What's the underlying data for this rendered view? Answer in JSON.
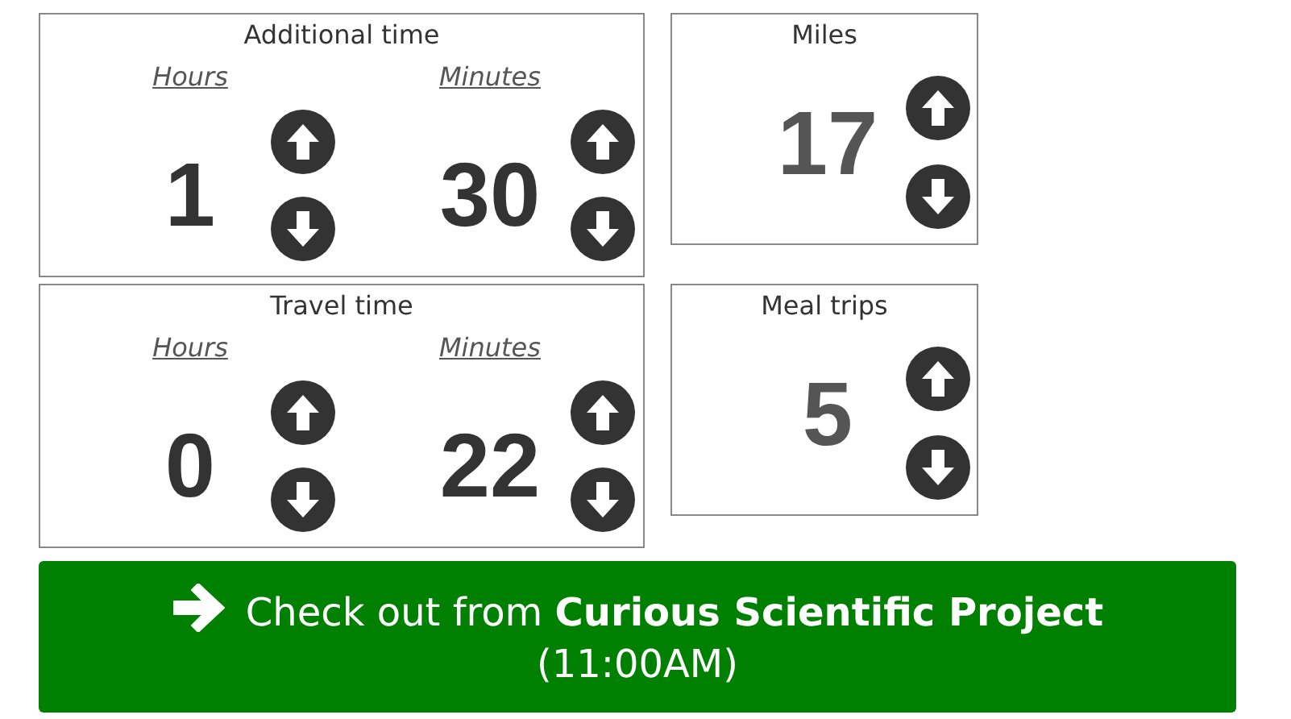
{
  "panels": [
    {
      "kind": "time",
      "title": "Additional time",
      "units": [
        {
          "label": "Hours",
          "value": "1"
        },
        {
          "label": "Minutes",
          "value": "30"
        }
      ]
    },
    {
      "kind": "count",
      "title": "Miles",
      "value": "17"
    },
    {
      "kind": "time",
      "title": "Travel time",
      "units": [
        {
          "label": "Hours",
          "value": "0"
        },
        {
          "label": "Minutes",
          "value": "22"
        }
      ]
    },
    {
      "kind": "count",
      "title": "Meal trips",
      "value": "5"
    }
  ],
  "checkout_button": {
    "text": "Check out from **Curious Scientific Project** (11:00AM)"
  }
}
